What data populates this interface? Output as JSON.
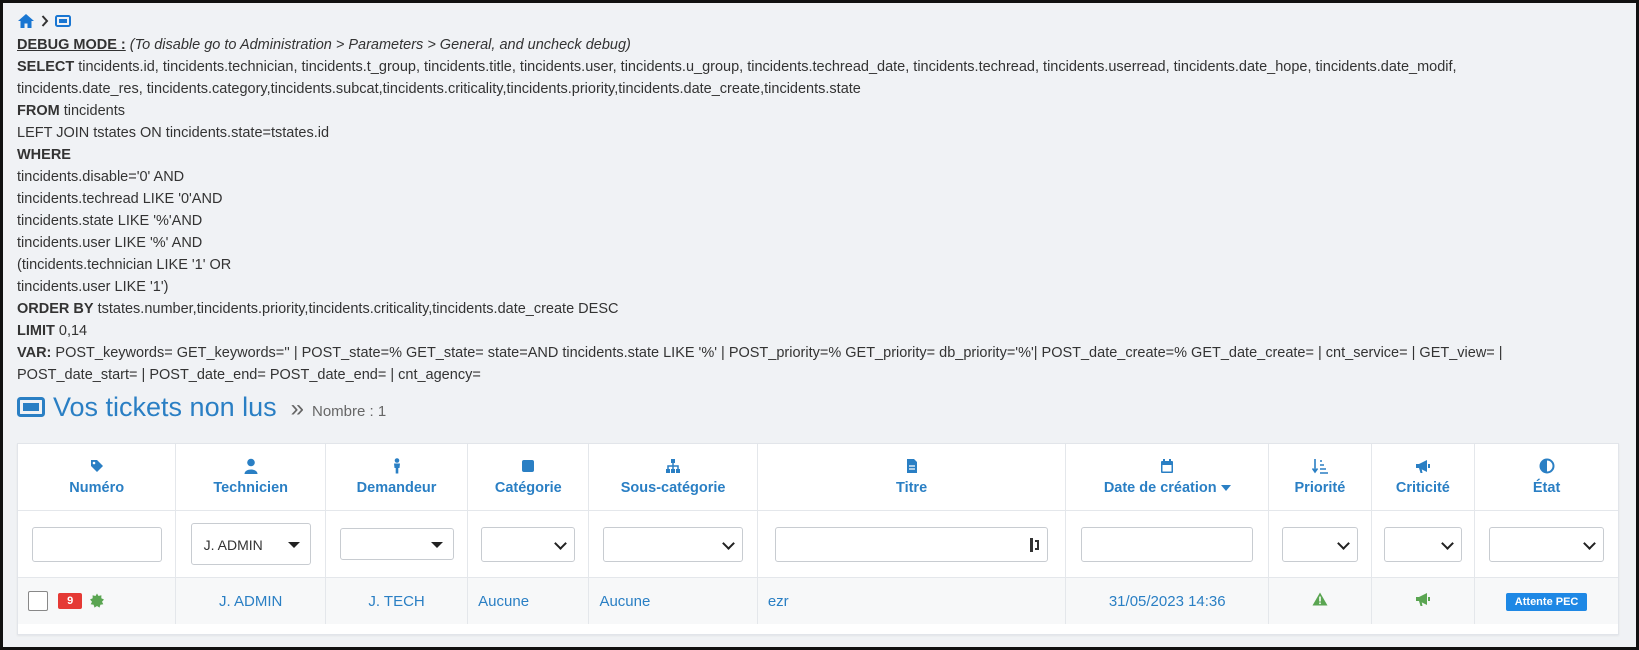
{
  "breadcrumb": {
    "home_icon": "home-icon",
    "separator_icon": "chevron-right-icon",
    "ticket_icon": "ticket-icon"
  },
  "debug": {
    "title": "DEBUG MODE :",
    "note": "(To disable go to Administration > Parameters > General, and uncheck debug)",
    "select_kw": "SELECT",
    "select_text": "tincidents.id, tincidents.technician, tincidents.t_group, tincidents.title, tincidents.user, tincidents.u_group, tincidents.techread_date, tincidents.techread, tincidents.userread, tincidents.date_hope, tincidents.date_modif,",
    "select_text2": "tincidents.date_res, tincidents.category,tincidents.subcat,tincidents.criticality,tincidents.priority,tincidents.date_create,tincidents.state",
    "from_kw": "FROM",
    "from_text": "tincidents",
    "join_line": "LEFT JOIN tstates ON tincidents.state=tstates.id",
    "where_kw": "WHERE",
    "where_lines": [
      "tincidents.disable='0' AND",
      "tincidents.techread LIKE '0'AND",
      "tincidents.state LIKE '%'AND",
      "tincidents.user LIKE '%' AND",
      "(tincidents.technician LIKE '1' OR",
      "tincidents.user LIKE '1')"
    ],
    "orderby_kw": "ORDER BY",
    "orderby_text": "tstates.number,tincidents.priority,tincidents.criticality,tincidents.date_create DESC",
    "limit_kw": "LIMIT",
    "limit_text": "0,14",
    "var_kw": "VAR:",
    "var_text": "POST_keywords= GET_keywords='' | POST_state=% GET_state= state=AND tincidents.state LIKE '%' | POST_priority=% GET_priority= db_priority='%'| POST_date_create=% GET_date_create= | cnt_service= | GET_view= |",
    "var_text2": "POST_date_start= | POST_date_end= POST_date_end= | cnt_agency="
  },
  "heading": {
    "title": "Vos tickets non lus",
    "count": "Nombre : 1"
  },
  "table": {
    "columns": {
      "numero": "Numéro",
      "technicien": "Technicien",
      "demandeur": "Demandeur",
      "categorie": "Catégorie",
      "souscategorie": "Sous-catégorie",
      "titre": "Titre",
      "datecreation": "Date de création",
      "priorite": "Priorité",
      "criticite": "Criticité",
      "etat": "État"
    },
    "filters": {
      "technicien": "J. ADMIN"
    },
    "row": {
      "numero": "9",
      "technicien": "J. ADMIN",
      "demandeur": "J. TECH",
      "categorie": "Aucune",
      "souscategorie": "Aucune",
      "titre": "ezr",
      "datecreation": "31/05/2023 14:36",
      "etat": "Attente PEC"
    }
  },
  "colors": {
    "accent": "#2a7fc4",
    "badge_red": "#e53935",
    "state_blue": "#1e88e5",
    "green": "#5aa552"
  }
}
